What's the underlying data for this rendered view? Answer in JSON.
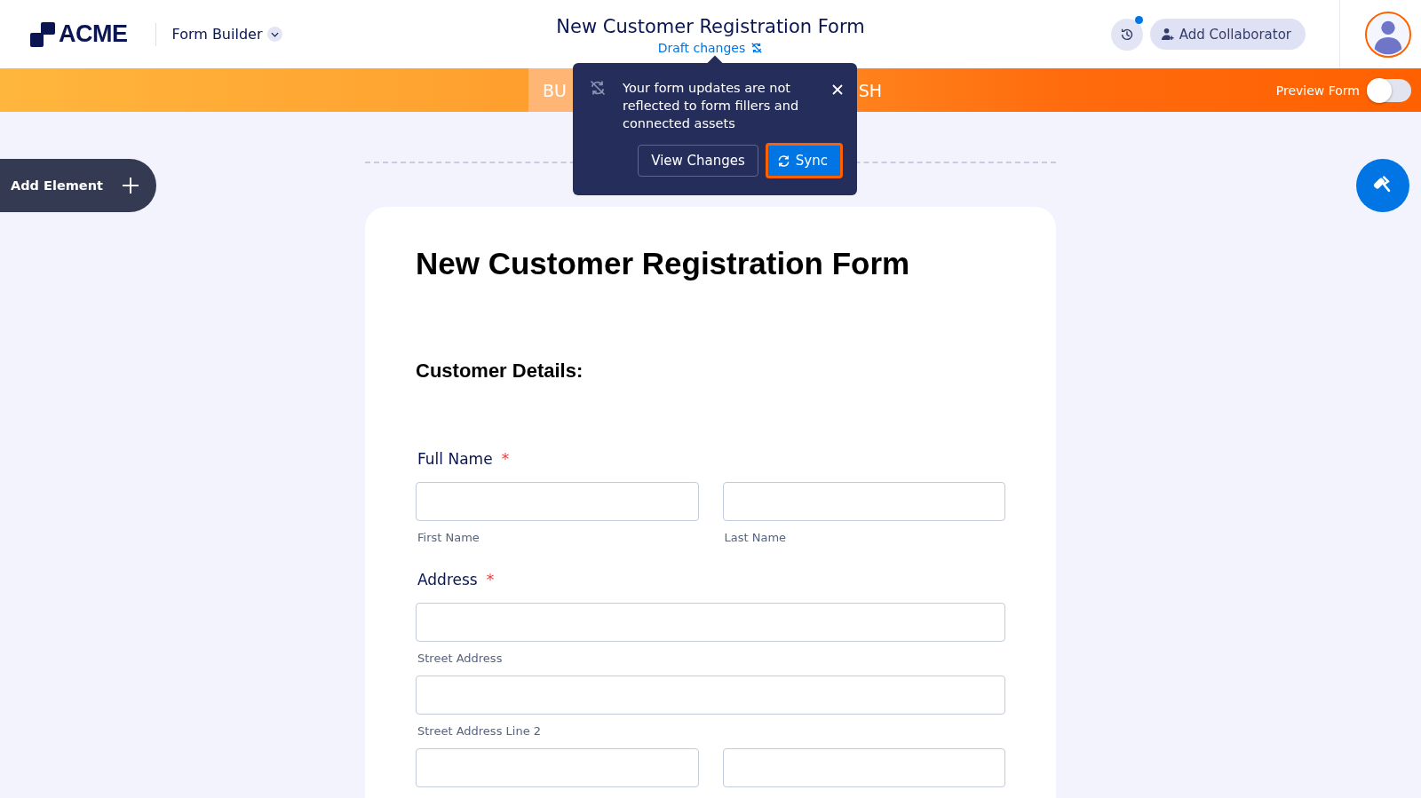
{
  "header": {
    "logo": "ACME",
    "app_menu": "Form Builder",
    "form_title": "New Customer Registration Form",
    "draft_status": "Draft changes",
    "history_has_update": true,
    "add_collaborator": "Add Collaborator"
  },
  "tabs": [
    {
      "label": "BU",
      "selected": true
    },
    {
      "label": "SH",
      "selected": false
    }
  ],
  "preview_form": {
    "label": "Preview Form",
    "on": false
  },
  "popover": {
    "message": "Your form updates are not reflected to form fillers and connected assets",
    "buttons": [
      {
        "label": "View Changes",
        "kind": "secondary"
      },
      {
        "label": "Sync",
        "kind": "primary"
      }
    ]
  },
  "add_element": "Add Element",
  "form": {
    "title": "New Customer Registration Form",
    "section": "Customer Details:",
    "fields": [
      {
        "label": "Full Name",
        "required_mark": "*",
        "rows": [
          [
            "First Name",
            "Last Name"
          ]
        ]
      },
      {
        "label": "Address",
        "required_mark": "*",
        "rows": [
          [
            "Street Address"
          ],
          [
            "Street Address Line 2"
          ],
          [
            null,
            null
          ]
        ]
      }
    ]
  }
}
